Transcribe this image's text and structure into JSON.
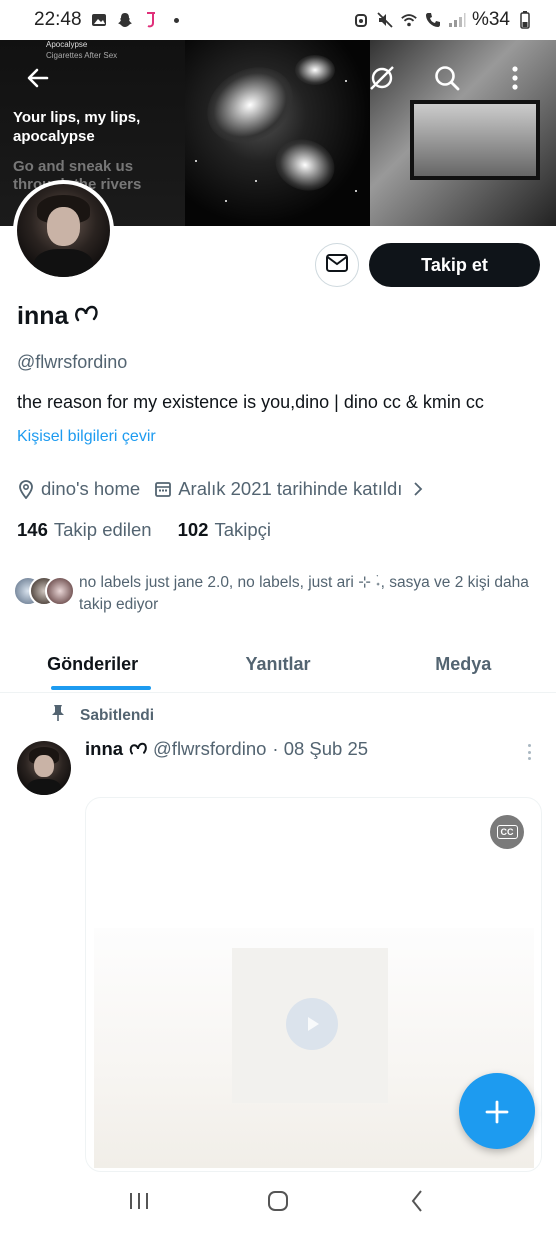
{
  "status_bar": {
    "time": "22:48",
    "battery": "%34"
  },
  "banner": {
    "now_playing_title": "Apocalypse",
    "now_playing_artist": "Cigarettes After Sex",
    "lyric_current": "Your lips, my lips, apocalypse",
    "lyric_next": "Go and sneak us through the rivers"
  },
  "profile": {
    "name": "inna",
    "handle": "@flwrsfordino",
    "bio": "the reason for my existence is you,dino | dino cc & kmin cc",
    "translate_link": "Kişisel bilgileri çevir",
    "location": "dino's home",
    "joined": "Aralık 2021 tarihinde katıldı",
    "following_count": "146",
    "following_label": "Takip edilen",
    "followers_count": "102",
    "followers_label": "Takipçi",
    "mutuals_text": "no labels just jane 2.0, no labels, just ari ⊹ ࣪˖, sasya ve 2 kişi daha takip ediyor",
    "follow_button": "Takip et"
  },
  "tabs": [
    {
      "label": "Gönderiler",
      "active": true
    },
    {
      "label": "Yanıtlar",
      "active": false
    },
    {
      "label": "Medya",
      "active": false
    }
  ],
  "pinned_post": {
    "pinned_label": "Sabitlendi",
    "author_name": "inna",
    "author_handle": "@flwrsfordino",
    "date": "· 08 Şub 25",
    "cc_label": "CC"
  },
  "colors": {
    "accent": "#1d9bf0",
    "text_primary": "#0f1419",
    "text_secondary": "#536471",
    "follow_button_bg": "#0f1419"
  },
  "icons": {
    "back": "arrow-left-icon",
    "disconnect": "no-sync-icon",
    "search": "search-icon",
    "more": "more-vertical-icon",
    "message": "envelope-icon",
    "location": "location-pin-icon",
    "calendar": "calendar-icon",
    "pin": "pin-icon",
    "compose": "plus-icon"
  }
}
